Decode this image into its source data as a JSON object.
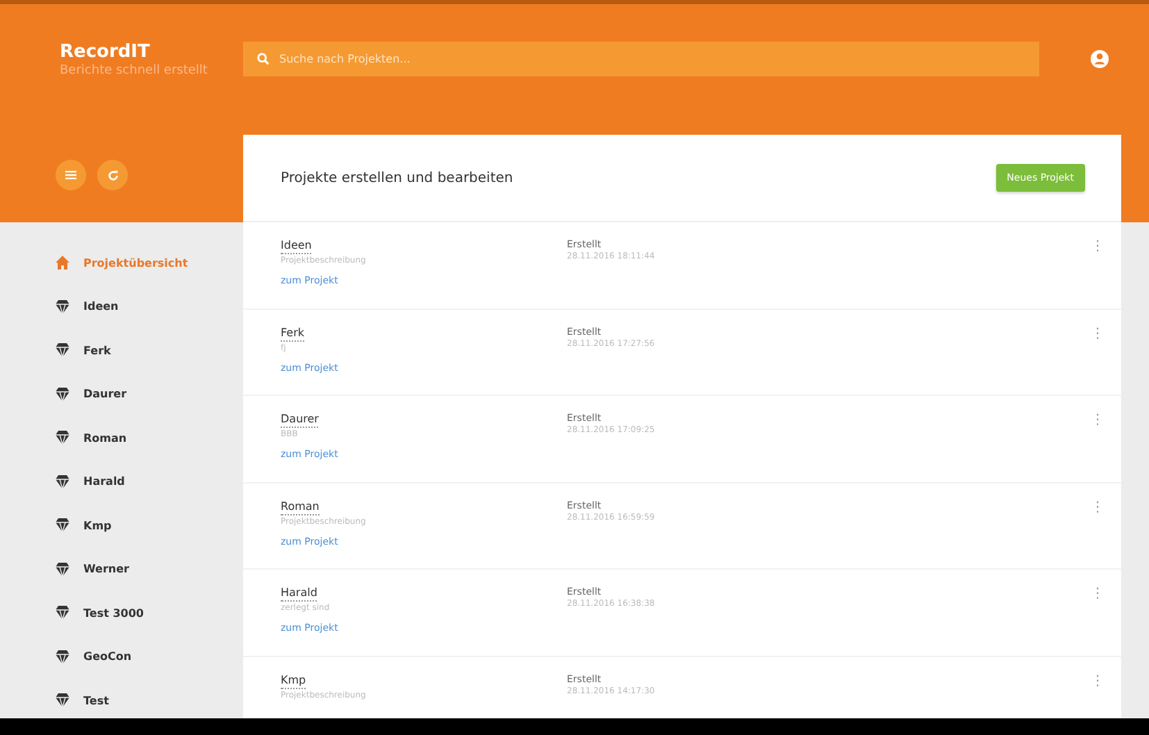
{
  "app": {
    "title": "RecordIT",
    "subtitle": "Berichte schnell erstellt"
  },
  "search": {
    "placeholder": "Suche nach Projekten..."
  },
  "sidebar": {
    "items": [
      {
        "label": "Projektübersicht",
        "kind": "home",
        "selected": true
      },
      {
        "label": "Ideen",
        "kind": "project",
        "selected": false
      },
      {
        "label": "Ferk",
        "kind": "project",
        "selected": false
      },
      {
        "label": "Daurer",
        "kind": "project",
        "selected": false
      },
      {
        "label": "Roman",
        "kind": "project",
        "selected": false
      },
      {
        "label": "Harald",
        "kind": "project",
        "selected": false
      },
      {
        "label": "Kmp",
        "kind": "project",
        "selected": false
      },
      {
        "label": "Werner",
        "kind": "project",
        "selected": false
      },
      {
        "label": "Test 3000",
        "kind": "project",
        "selected": false
      },
      {
        "label": "GeoCon",
        "kind": "project",
        "selected": false
      },
      {
        "label": "Test",
        "kind": "project",
        "selected": false
      }
    ]
  },
  "card": {
    "title": "Projekte erstellen und bearbeiten",
    "new_button": "Neues Projekt",
    "projects": [
      {
        "name": "Ideen",
        "description": "Projektbeschreibung",
        "link": "zum Projekt",
        "created_label": "Erstellt",
        "created": "28.11.2016 18:11:44",
        "menu": "⋮"
      },
      {
        "name": "Ferk",
        "description": "fj",
        "link": "zum Projekt",
        "created_label": "Erstellt",
        "created": "28.11.2016 17:27:56",
        "menu": "⋮"
      },
      {
        "name": "Daurer",
        "description": "BBB",
        "link": "zum Projekt",
        "created_label": "Erstellt",
        "created": "28.11.2016 17:09:25",
        "menu": "⋮"
      },
      {
        "name": "Roman",
        "description": "Projektbeschreibung",
        "link": "zum Projekt",
        "created_label": "Erstellt",
        "created": "28.11.2016 16:59:59",
        "menu": "⋮"
      },
      {
        "name": "Harald",
        "description": "zerlegt sind",
        "link": "zum Projekt",
        "created_label": "Erstellt",
        "created": "28.11.2016 16:38:38",
        "menu": "⋮"
      },
      {
        "name": "Kmp",
        "description": "Projektbeschreibung",
        "created_label": "Erstellt",
        "created": "28.11.2016 14:17:30",
        "menu": "⋮"
      }
    ]
  }
}
